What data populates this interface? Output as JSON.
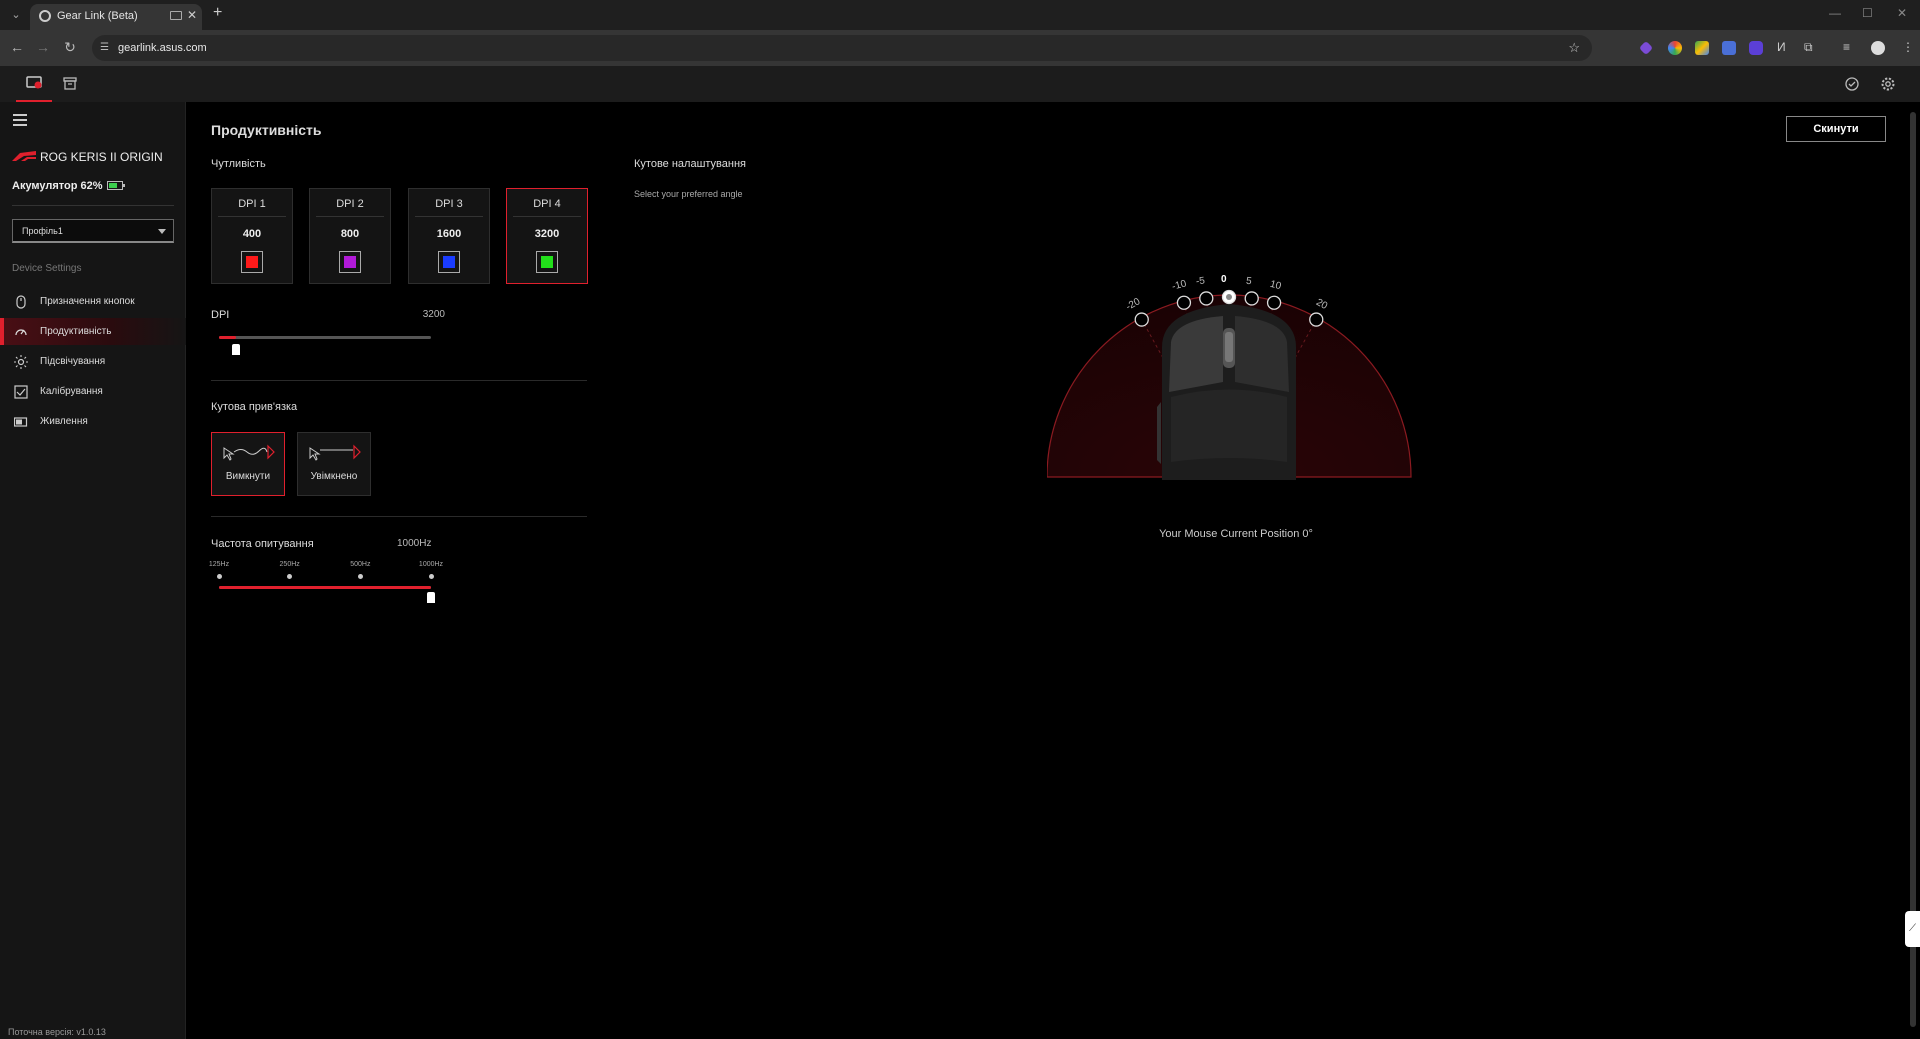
{
  "browser": {
    "tab_title": "Gear Link (Beta)",
    "url": "gearlink.asus.com",
    "new_tab": "+",
    "close": "✕"
  },
  "sidebar": {
    "device_name": "ROG KERIS II ORIGIN",
    "battery_label": "Акумулятор 62%",
    "battery_level": 0.62,
    "profile_value": "Профіль1",
    "section_label": "Device Settings",
    "items": [
      {
        "label": "Призначення кнопок",
        "icon": "mouse-icon",
        "active": false
      },
      {
        "label": "Продуктивність",
        "icon": "gauge-icon",
        "active": true
      },
      {
        "label": "Підсвічування",
        "icon": "lighting-icon",
        "active": false
      },
      {
        "label": "Калібрування",
        "icon": "calibration-icon",
        "active": false
      },
      {
        "label": "Живлення",
        "icon": "battery-icon",
        "active": false
      }
    ],
    "version": "Поточна версія: v1.0.13"
  },
  "main": {
    "title": "Продуктивність",
    "reset_label": "Скинути",
    "sensitivity_label": "Чутливість",
    "dpi_stages": [
      {
        "name": "DPI 1",
        "value": "400",
        "color": "#ff1a1a",
        "selected": false
      },
      {
        "name": "DPI 2",
        "value": "800",
        "color": "#b21ad8",
        "selected": false
      },
      {
        "name": "DPI 3",
        "value": "1600",
        "color": "#1a3cff",
        "selected": false
      },
      {
        "name": "DPI 4",
        "value": "3200",
        "color": "#22e01a",
        "selected": true
      }
    ],
    "dpi_label": "DPI",
    "dpi_value": "3200",
    "dpi_slider_fraction": 0.08,
    "angle_snap_label": "Кутова прив'язка",
    "angle_snap_options": [
      {
        "label": "Вимкнути",
        "selected": true
      },
      {
        "label": "Увімкнено",
        "selected": false
      }
    ],
    "polling_label": "Частота опитування",
    "polling_value": "1000Hz",
    "polling_ticks": [
      "125Hz",
      "250Hz",
      "500Hz",
      "1000Hz"
    ],
    "polling_slider_fraction": 1.0,
    "angle_tuning_label": "Кутове налаштування",
    "angle_tuning_sub": "Select your preferred angle",
    "angle_marks": [
      "-20",
      "-10",
      "-5",
      "0",
      "5",
      "10",
      "20"
    ],
    "angle_selected": "0",
    "current_position": "Your Mouse Current Position 0°"
  },
  "colors": {
    "accent": "#e0202d",
    "background": "#000000",
    "sidebar": "#151515"
  }
}
